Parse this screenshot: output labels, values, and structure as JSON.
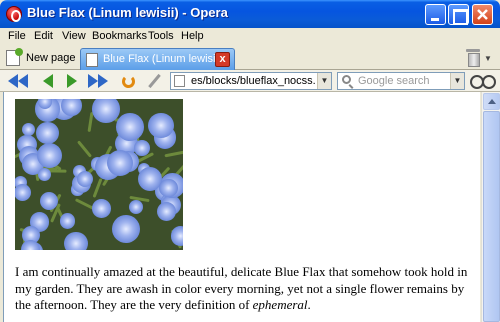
{
  "window": {
    "title": "Blue Flax (Linum lewisii) - Opera"
  },
  "menu": {
    "items": [
      "File",
      "Edit",
      "View",
      "Bookmarks",
      "Tools",
      "Help"
    ]
  },
  "tabs": {
    "new_tab_label": "New page",
    "active_tab_label": "Blue Flax (Linum lewisii)",
    "close_glyph": "x"
  },
  "toolbar": {
    "address": "es/blocks/blueflax_nocss.html",
    "search_placeholder": "Google search"
  },
  "page": {
    "paragraph_main": "I am continually amazed at the beautiful, delicate Blue Flax that somehow took hold in my garden. They are awash in color every morning, yet not a single flower remains by the afternoon. They are the very definition of ",
    "paragraph_em": "ephemeral",
    "paragraph_end": "."
  },
  "colors": {
    "titlebar": "#0a5fe4",
    "tab_active": "#5b9ee8",
    "flower": "#8ea6e8"
  }
}
